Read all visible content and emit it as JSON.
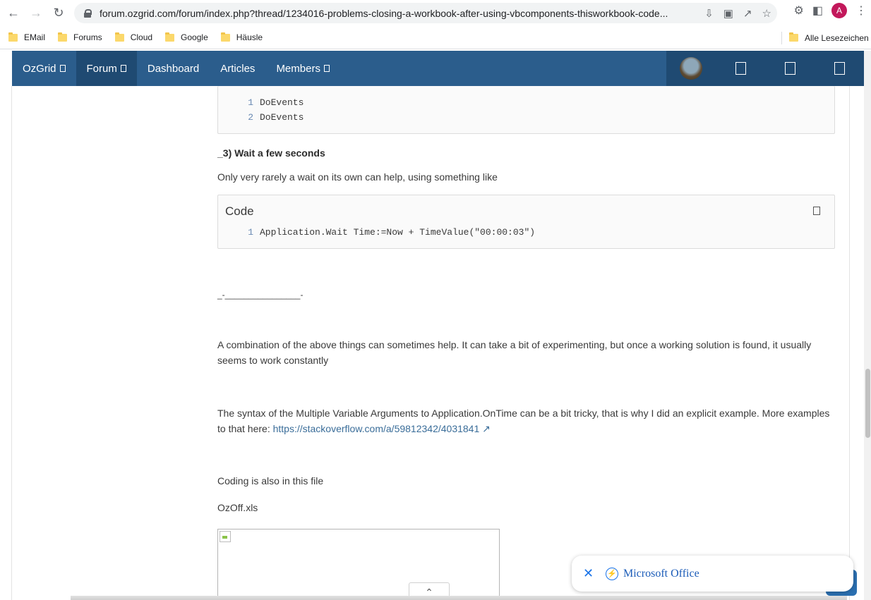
{
  "browser": {
    "url": "forum.ozgrid.com/forum/index.php?thread/1234016-problems-closing-a-workbook-after-using-vbcomponents-thisworkbook-code...",
    "profile_initial": "A",
    "bookmarks": [
      "EMail",
      "Forums",
      "Cloud",
      "Google",
      "Häusle"
    ],
    "bookmarks_right": "Alle Lesezeichen"
  },
  "site_nav": {
    "items": [
      {
        "label": "OzGrid",
        "has_menu": true
      },
      {
        "label": "Forum",
        "has_menu": true
      },
      {
        "label": "Dashboard",
        "has_menu": false
      },
      {
        "label": "Articles",
        "has_menu": false
      },
      {
        "label": "Members",
        "has_menu": true
      }
    ]
  },
  "post": {
    "code1_lines": [
      {
        "num": "1",
        "code": "DoEvents"
      },
      {
        "num": "2",
        "code": "DoEvents"
      }
    ],
    "heading3": "_3) Wait a few seconds",
    "para_wait": "Only very rarely a wait on its own can help, using something like",
    "code2_title": "Code",
    "code2_lines": [
      {
        "num": "1",
        "code": "Application.Wait Time:=Now + TimeValue(\"00:00:03\")"
      }
    ],
    "divider": "_-________________-",
    "para_combination": "A combination of the above things can sometimes help. It can take a bit of experimenting, but once a working solution is found, it usually seems to work constantly",
    "para_syntax": "The syntax of the Multiple Variable Arguments to Application.OnTime can be a bit tricky, that is why I did an explicit example. More examples to that here: ",
    "syntax_link": "https://stackoverflow.com/a/59812342/4031841 ↗",
    "para_coding": "Coding is also in this file",
    "attachment_name": "OzOff.xls"
  },
  "popup": {
    "label": "Microsoft Office"
  }
}
